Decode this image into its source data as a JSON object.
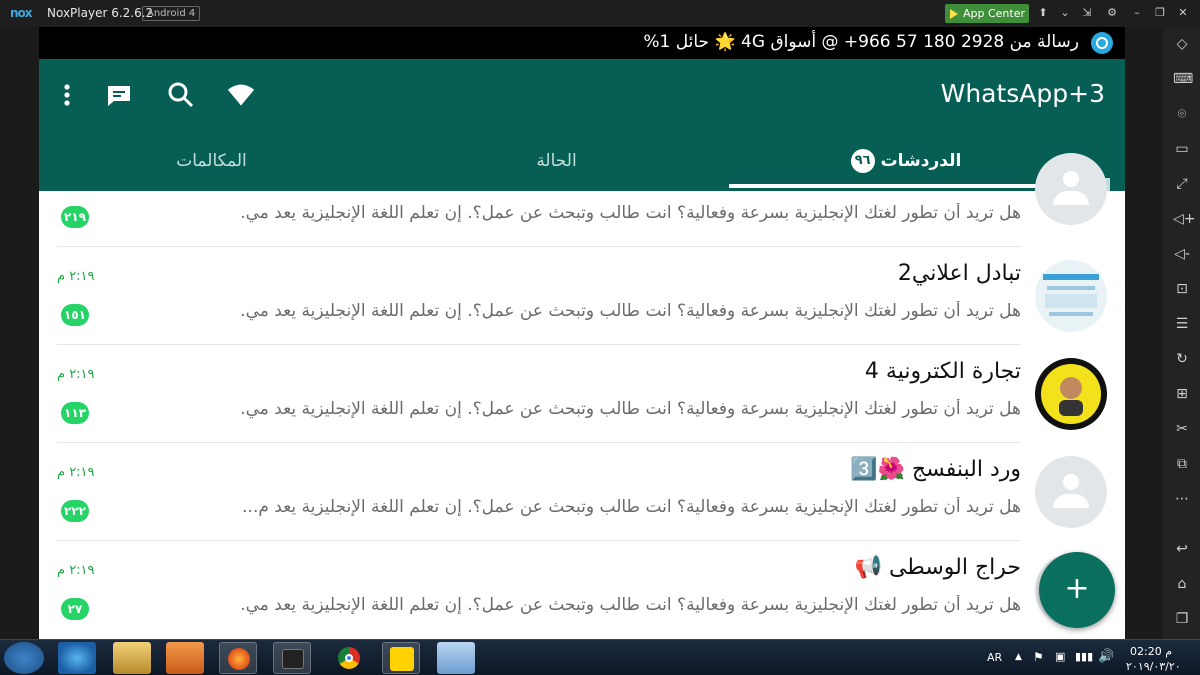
{
  "emulator": {
    "title": "NoxPlayer 6.2.6.2",
    "badge": "Android 4",
    "logo": "nox",
    "app_center": "App Center"
  },
  "status_bar": {
    "text": "رسالة من 2928 180 57 966+ @ أسواق 4G 🌟 حائل 1%"
  },
  "app": {
    "title": "WhatsApp+3",
    "tabs": [
      {
        "label": "المكالمات"
      },
      {
        "label": "الحالة"
      },
      {
        "label": "الدردشات",
        "count": "٩٦"
      }
    ]
  },
  "chats": [
    {
      "name": "",
      "time": "",
      "message": "هل تريد أن تطور لغتك الإنجليزية بسرعة وفعالية؟ انت طالب وتبحث عن عمل؟. إن تعلم اللغة الإنجليزية يعد مي.",
      "badge": "٢١٩"
    },
    {
      "name": "تبادل اعلاني2",
      "time": "٢:١٩ م",
      "message": "هل تريد أن تطور لغتك الإنجليزية بسرعة وفعالية؟ انت طالب وتبحث عن عمل؟. إن تعلم اللغة الإنجليزية يعد مي.",
      "badge": "١٥١"
    },
    {
      "name": "تجارة الكترونية 4",
      "time": "٢:١٩ م",
      "message": "هل تريد أن تطور لغتك الإنجليزية بسرعة وفعالية؟ انت طالب وتبحث عن عمل؟. إن تعلم اللغة الإنجليزية يعد مي.",
      "badge": "١١٣"
    },
    {
      "name": "ورد البنفسج 🌺3️⃣",
      "time": "٢:١٩ م",
      "message": "هل تريد أن تطور لغتك الإنجليزية بسرعة وفعالية؟ انت طالب وتبحث عن عمل؟. إن تعلم اللغة الإنجليزية يعد م...",
      "badge": "٢٢٢"
    },
    {
      "name": "حراج الوسطى 📢",
      "time": "٢:١٩ م",
      "message": "هل تريد أن تطور لغتك الإنجليزية بسرعة وفعالية؟ انت طالب وتبحث عن عمل؟. إن تعلم اللغة الإنجليزية يعد مي.",
      "badge": "٢٧"
    }
  ],
  "fab": {
    "label": "+"
  },
  "taskbar": {
    "lang": "AR",
    "time": "02:20 م",
    "date": "٢٠١٩/٠٣/٢٠"
  },
  "colors": {
    "primary": "#075e54",
    "accent": "#25d366",
    "time_green": "#25a549"
  }
}
